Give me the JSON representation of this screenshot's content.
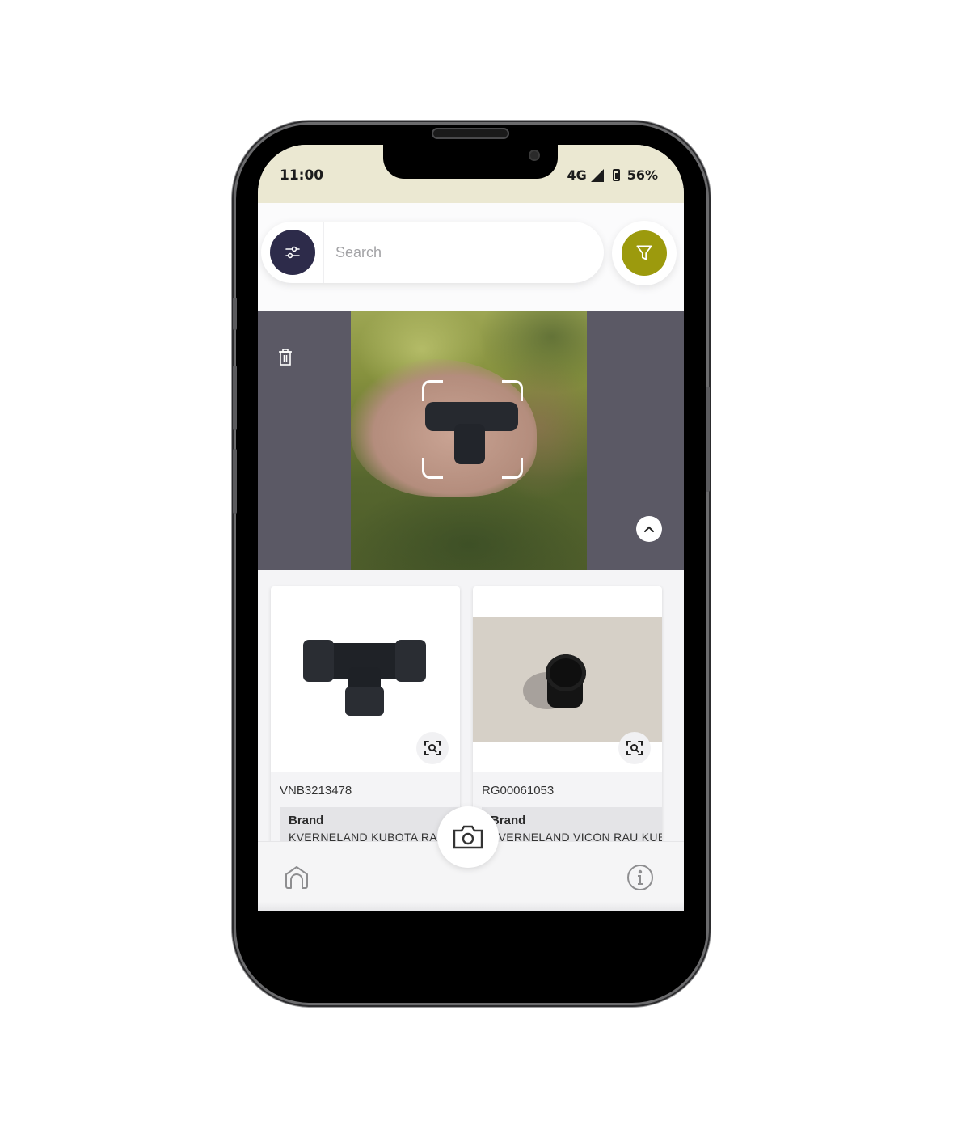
{
  "status_bar": {
    "time": "11:00",
    "network": "4G",
    "battery": "56%",
    "icons": [
      "signal-icon",
      "battery-icon"
    ]
  },
  "search": {
    "placeholder": "Search",
    "value": "",
    "settings_icon": "sliders-icon",
    "filter_icon": "funnel-icon"
  },
  "preview": {
    "delete_icon": "trash-icon",
    "collapse_icon": "chevron-up-icon",
    "scan_icon": "scan-frame"
  },
  "results": [
    {
      "id": "VNB3213478",
      "brand_label": "Brand",
      "brand_value": "KVERNELAND KUBOTA RAU",
      "zoom_icon": "scan-search-icon"
    },
    {
      "id": "RG00061053",
      "brand_label": "Brand",
      "brand_value": "KVERNELAND VICON RAU KUBOTA",
      "zoom_icon": "scan-search-icon"
    }
  ],
  "bottom_nav": {
    "home_icon": "home-icon",
    "camera_icon": "camera-icon",
    "info_icon": "info-icon"
  },
  "colors": {
    "status_bar_bg": "#ebe8d2",
    "settings_button": "#2d2b4a",
    "filter_button": "#9c9a0d",
    "preview_bg": "#5b5965"
  }
}
